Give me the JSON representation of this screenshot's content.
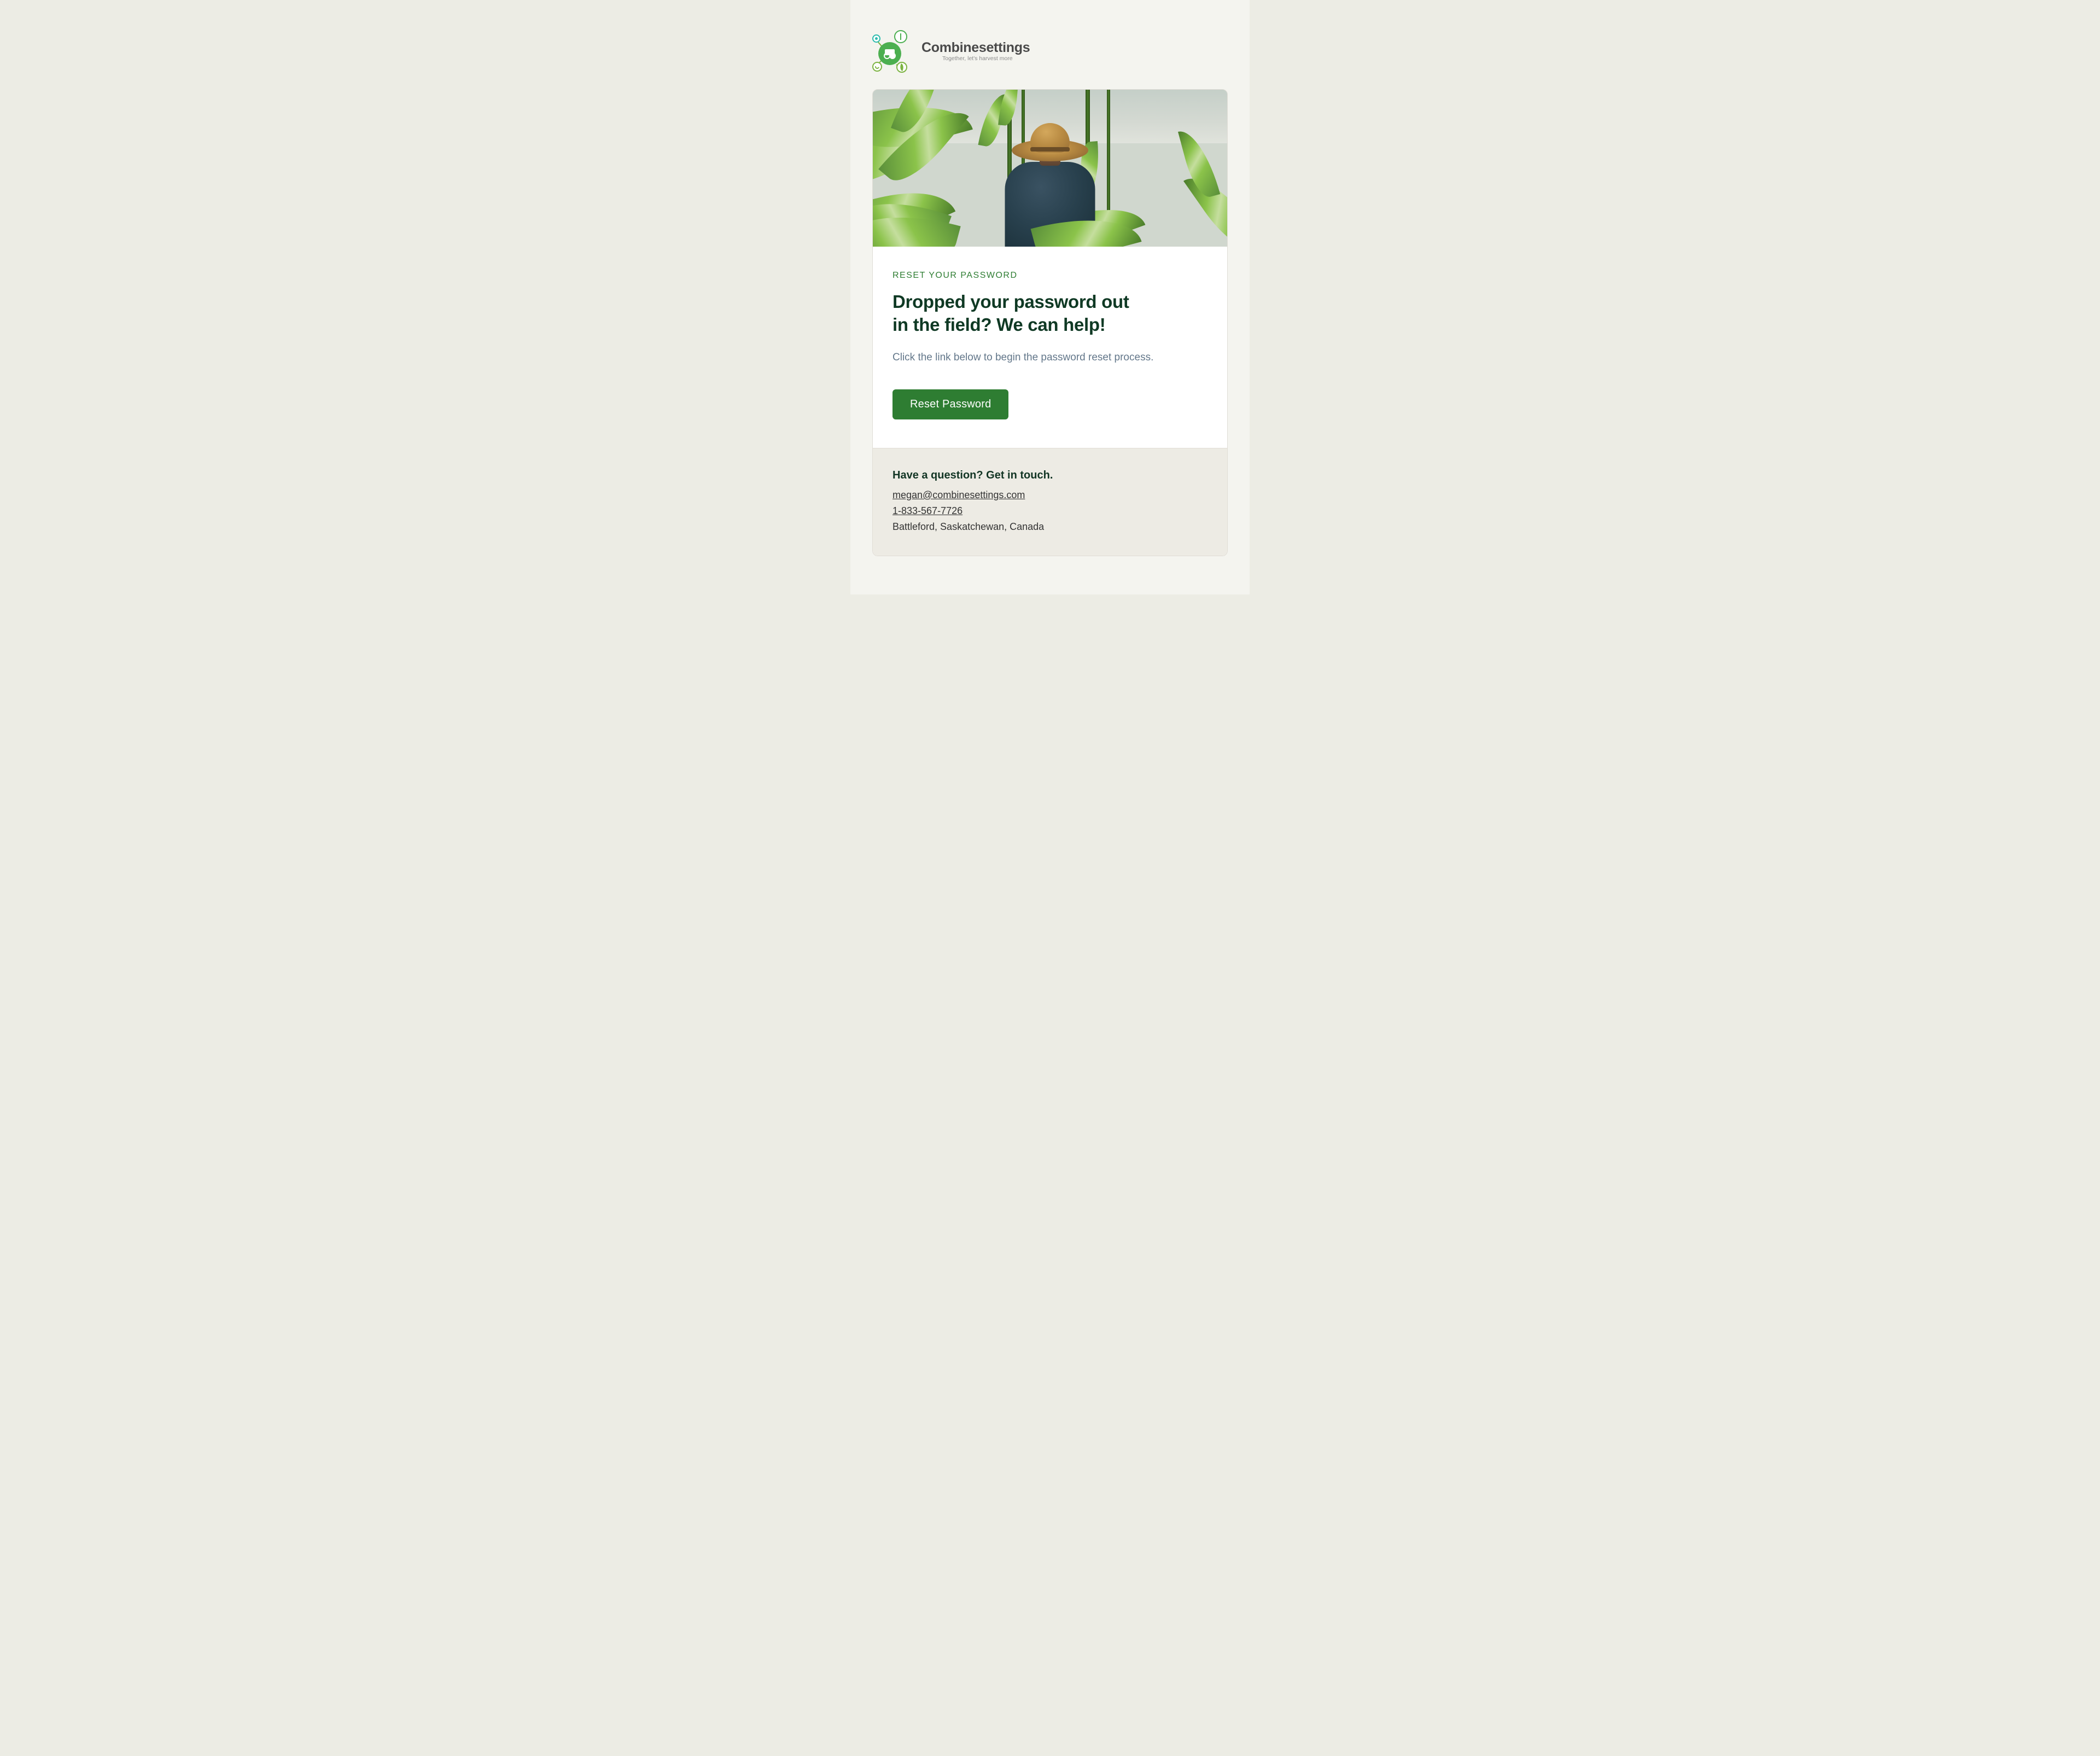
{
  "logo": {
    "title": "Combinesettings",
    "tagline": "Together, let's harvest more"
  },
  "content": {
    "eyebrow": "RESET YOUR PASSWORD",
    "heading_line1": "Dropped your password out",
    "heading_line2": "in the field? We can help!",
    "subtext": "Click the link below to begin the password reset process.",
    "button_label": "Reset Password"
  },
  "footer": {
    "heading": "Have a question? Get in touch.",
    "email": "megan@combinesettings.com",
    "phone": "1-833-567-7726",
    "address": "Battleford, Saskatchewan, Canada"
  },
  "colors": {
    "primary_green": "#2e7d32",
    "dark_green": "#0f3924",
    "light_bg": "#f4f4ef",
    "outer_bg": "#ecece4",
    "footer_bg": "#edebe4",
    "muted_text": "#63778a"
  }
}
